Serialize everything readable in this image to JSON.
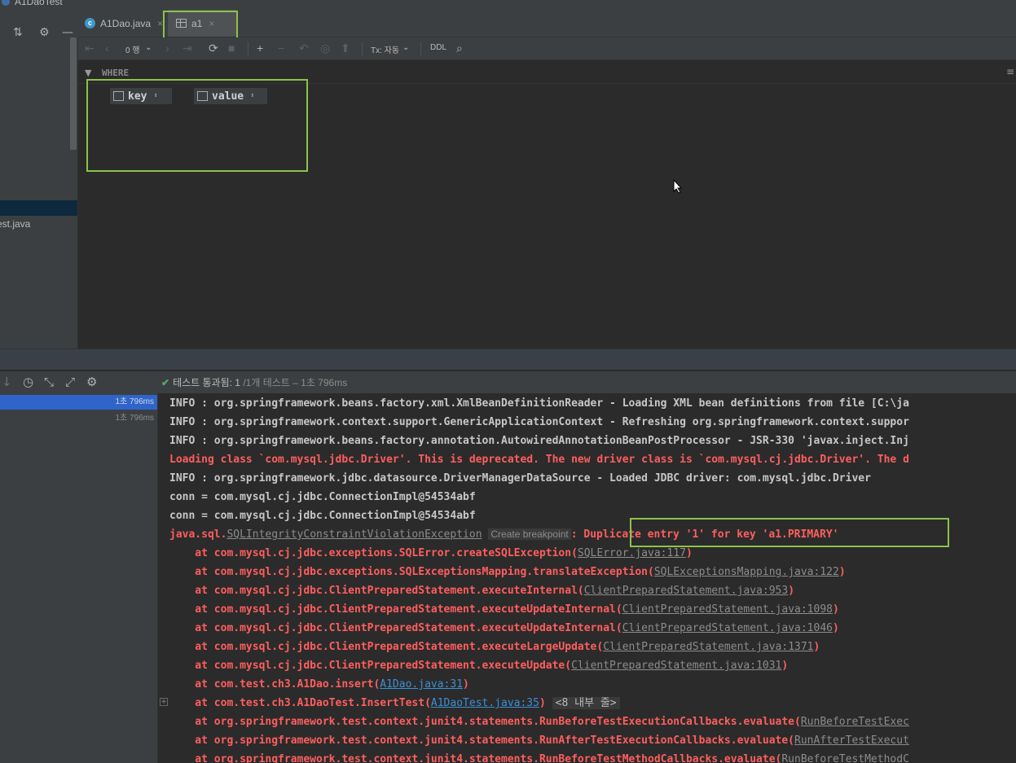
{
  "window": {
    "title": "A1DaoTest"
  },
  "left_panel": {
    "item_label": "Test.java"
  },
  "tabs": [
    {
      "label": "A1Dao.java"
    },
    {
      "label": "a1"
    }
  ],
  "data_toolbar": {
    "rows_label": "0 행",
    "tx_label": "Tx: 자동",
    "ddl_label": "DDL"
  },
  "filter": {
    "where_label": "WHERE"
  },
  "grid": {
    "columns": [
      "key",
      "value"
    ]
  },
  "run": {
    "status_pass": "테스트 통과됨: 1",
    "status_rest": " /1개 테스트 – 1초 796ms",
    "tree": [
      "1초 796ms",
      "1초 796ms"
    ]
  },
  "console": {
    "lines": [
      "INFO : org.springframework.beans.factory.xml.XmlBeanDefinitionReader - Loading XML bean definitions from file [C:\\ja",
      "INFO : org.springframework.context.support.GenericApplicationContext - Refreshing org.springframework.context.suppor",
      "INFO : org.springframework.beans.factory.annotation.AutowiredAnnotationBeanPostProcessor - JSR-330 'javax.inject.Inj",
      "Loading class `com.mysql.jdbc.Driver'. This is deprecated. The new driver class is `com.mysql.cj.jdbc.Driver'. The d",
      "INFO : org.springframework.jdbc.datasource.DriverManagerDataSource - Loaded JDBC driver: com.mysql.jdbc.Driver",
      "conn = com.mysql.cj.jdbc.ConnectionImpl@54534abf",
      "conn = com.mysql.cj.jdbc.ConnectionImpl@54534abf"
    ],
    "exception": {
      "prefix": "java.sql.",
      "class_link": "SQLIntegrityConstraintViolationException",
      "breakpoint": "Create breakpoint",
      "message": ": Duplicate entry '1' for key 'a1.PRIMARY'"
    },
    "stack": [
      {
        "at": "    at com.mysql.cj.jdbc.exceptions.SQLError.createSQLException(",
        "link": "SQLError.java:117",
        "end": ")",
        "blue": false
      },
      {
        "at": "    at com.mysql.cj.jdbc.exceptions.SQLExceptionsMapping.translateException(",
        "link": "SQLExceptionsMapping.java:122",
        "end": ")",
        "blue": false
      },
      {
        "at": "    at com.mysql.cj.jdbc.ClientPreparedStatement.executeInternal(",
        "link": "ClientPreparedStatement.java:953",
        "end": ")",
        "blue": false
      },
      {
        "at": "    at com.mysql.cj.jdbc.ClientPreparedStatement.executeUpdateInternal(",
        "link": "ClientPreparedStatement.java:1098",
        "end": ")",
        "blue": false
      },
      {
        "at": "    at com.mysql.cj.jdbc.ClientPreparedStatement.executeUpdateInternal(",
        "link": "ClientPreparedStatement.java:1046",
        "end": ")",
        "blue": false
      },
      {
        "at": "    at com.mysql.cj.jdbc.ClientPreparedStatement.executeLargeUpdate(",
        "link": "ClientPreparedStatement.java:1371",
        "end": ")",
        "blue": false
      },
      {
        "at": "    at com.mysql.cj.jdbc.ClientPreparedStatement.executeUpdate(",
        "link": "ClientPreparedStatement.java:1031",
        "end": ")",
        "blue": false
      },
      {
        "at": "    at com.test.ch3.A1Dao.insert(",
        "link": "A1Dao.java:31",
        "end": ")",
        "blue": true
      },
      {
        "at": "    at com.test.ch3.A1DaoTest.InsertTest(",
        "link": "A1DaoTest.java:35",
        "end": ")",
        "blue": true,
        "collapsed": "<8 내부 줄>"
      },
      {
        "at": "    at org.springframework.test.context.junit4.statements.RunBeforeTestExecutionCallbacks.evaluate(",
        "link": "RunBeforeTestExec",
        "end": "",
        "blue": false
      },
      {
        "at": "    at org.springframework.test.context.junit4.statements.RunAfterTestExecutionCallbacks.evaluate(",
        "link": "RunAfterTestExecut",
        "end": "",
        "blue": false
      },
      {
        "at": "    at org.springframework.test.context.junit4.statements.RunBeforeTestMethodCallbacks.evaluate(",
        "link": "RunBeforeTestMethodC",
        "end": "",
        "blue": false
      }
    ]
  },
  "colors": {
    "accent_highlight": "#8bc34a",
    "error_text": "#ff5e5e",
    "pass_check": "#59a869",
    "selection": "#2f65ca"
  }
}
